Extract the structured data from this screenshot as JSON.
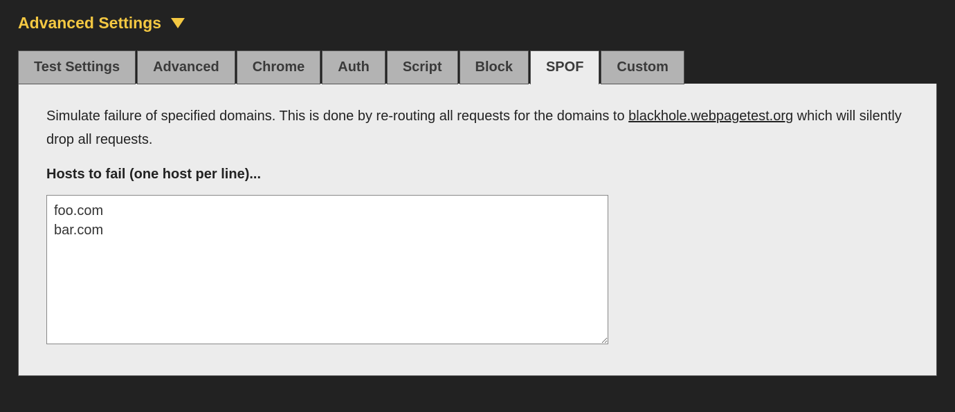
{
  "header": {
    "title": "Advanced Settings"
  },
  "tabs": [
    {
      "label": "Test Settings",
      "active": false
    },
    {
      "label": "Advanced",
      "active": false
    },
    {
      "label": "Chrome",
      "active": false
    },
    {
      "label": "Auth",
      "active": false
    },
    {
      "label": "Script",
      "active": false
    },
    {
      "label": "Block",
      "active": false
    },
    {
      "label": "SPOF",
      "active": true
    },
    {
      "label": "Custom",
      "active": false
    }
  ],
  "panel": {
    "description_pre": "Simulate failure of specified domains. This is done by re-routing all requests for the domains to ",
    "blackhole_link": "blackhole.webpagetest.org",
    "description_post": " which will silently drop all requests.",
    "field_label": "Hosts to fail (one host per line)...",
    "hosts_value": "foo.com\nbar.com"
  }
}
